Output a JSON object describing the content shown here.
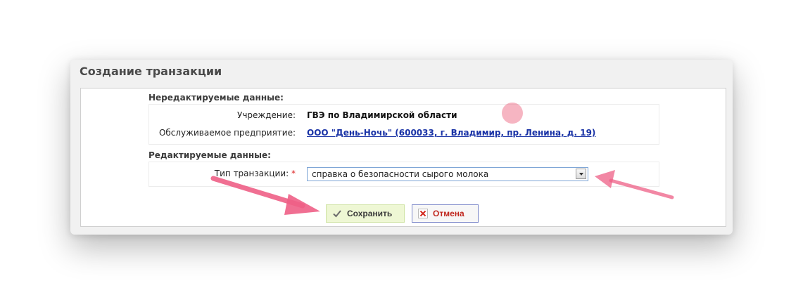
{
  "dialog": {
    "title": "Создание транзакции"
  },
  "readonly_section": {
    "title": "Нередактируемые данные:",
    "institution_label": "Учреждение:",
    "institution_value": "ГВЭ по Владимирской области",
    "enterprise_label": "Обслуживаемое предприятие:",
    "enterprise_value": "ООО \"День-Ночь\" (600033, г. Владимир, пр. Ленина, д. 19)"
  },
  "editable_section": {
    "title": "Редактируемые данные:",
    "transaction_type_label": "Тип транзакции:",
    "required_mark": "*",
    "transaction_type_value": "справка о безопасности сырого молока"
  },
  "buttons": {
    "save_label": "Сохранить",
    "cancel_label": "Отмена"
  },
  "colors": {
    "link": "#1a33a6",
    "required": "#dd2222",
    "cancel_text": "#c0271e",
    "save_bg": "#eef7d4",
    "annotation_arrow": "#ee5f86"
  },
  "icons": {
    "save": "check-icon",
    "cancel": "x-icon",
    "dropdown": "chevron-down-icon"
  }
}
